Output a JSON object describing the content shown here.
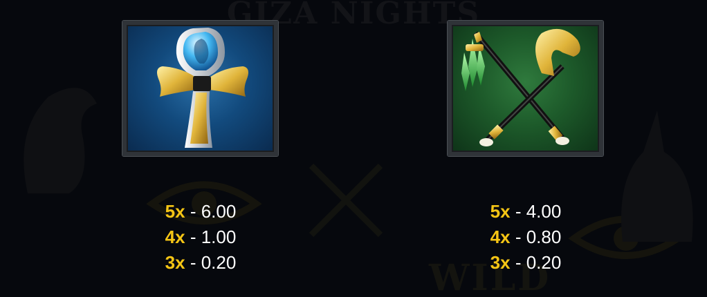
{
  "background": {
    "title": "GIZA NIGHTS",
    "partial_word": "WILD"
  },
  "symbols": [
    {
      "name": "Ankh",
      "icon": "ankh-icon",
      "frame_color": "#124a7d",
      "payouts": [
        {
          "multiplier": "5x",
          "separator": "-",
          "value": "6.00"
        },
        {
          "multiplier": "4x",
          "separator": "-",
          "value": "1.00"
        },
        {
          "multiplier": "3x",
          "separator": "-",
          "value": "0.20"
        }
      ]
    },
    {
      "name": "Crook and Flail",
      "icon": "crook-and-flail-icon",
      "frame_color": "#1d5a2a",
      "payouts": [
        {
          "multiplier": "5x",
          "separator": "-",
          "value": "4.00"
        },
        {
          "multiplier": "4x",
          "separator": "-",
          "value": "0.80"
        },
        {
          "multiplier": "3x",
          "separator": "-",
          "value": "0.20"
        }
      ]
    }
  ],
  "colors": {
    "multiplier": "#f5c515",
    "value": "#ffffff",
    "background": "#06080d"
  }
}
